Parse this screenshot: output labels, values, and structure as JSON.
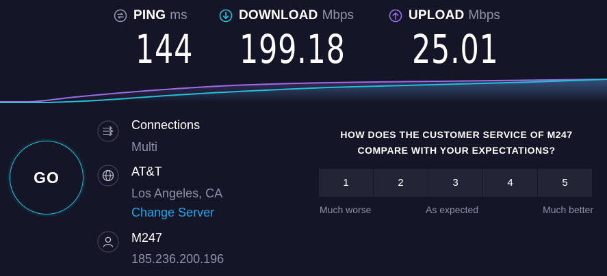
{
  "colors": {
    "background": "#141526",
    "download": "#1fc2d8",
    "upload": "#9b6ee8",
    "ping_icon": "#9193a8",
    "link": "#1ea6e6",
    "muted": "#8f91a6"
  },
  "metrics": {
    "ping": {
      "label": "PING",
      "unit": "ms",
      "value": "144",
      "icon": "ping-icon"
    },
    "download": {
      "label": "DOWNLOAD",
      "unit": "Mbps",
      "value": "199.18",
      "icon": "download-arrow-icon"
    },
    "upload": {
      "label": "UPLOAD",
      "unit": "Mbps",
      "value": "25.01",
      "icon": "upload-arrow-icon"
    }
  },
  "go_button": {
    "label": "GO"
  },
  "connections": {
    "title": "Connections",
    "value": "Multi",
    "icon": "connections-icon"
  },
  "server": {
    "name": "AT&T",
    "location": "Los Angeles, CA",
    "change_label": "Change Server",
    "icon": "globe-icon"
  },
  "user": {
    "provider": "M247",
    "ip": "185.236.200.196",
    "icon": "user-icon"
  },
  "survey": {
    "question_line1": "HOW DOES THE CUSTOMER SERVICE OF M247",
    "question_line2": "COMPARE WITH YOUR EXPECTATIONS?",
    "options": [
      "1",
      "2",
      "3",
      "4",
      "5"
    ],
    "label_low": "Much worse",
    "label_mid": "As expected",
    "label_high": "Much better"
  }
}
